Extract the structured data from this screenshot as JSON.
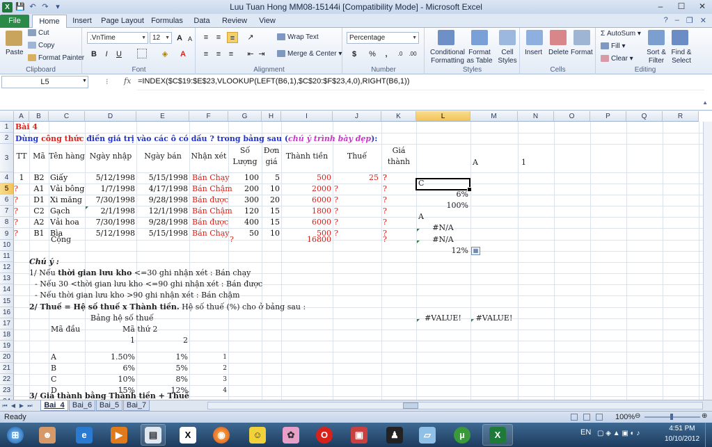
{
  "window": {
    "title": "Luu Tuan Hong MM08-15144i  [Compatibility Mode]  -  Microsoft Excel",
    "min": "–",
    "max": "☐",
    "close": "✕"
  },
  "quick_access": {
    "save": "💾",
    "undo": "↶",
    "redo": "↷",
    "more": "▾"
  },
  "tabs": [
    "File",
    "Home",
    "Insert",
    "Page Layout",
    "Formulas",
    "Data",
    "Review",
    "View"
  ],
  "ribbon": {
    "clipboard": {
      "label": "Clipboard",
      "paste": "Paste",
      "cut": "Cut",
      "copy": "Copy",
      "format_painter": "Format Painter"
    },
    "font": {
      "label": "Font",
      "name": ".VnTime",
      "size": "12",
      "bold": "B",
      "italic": "I",
      "underline": "U",
      "grow": "A",
      "shrink": "A"
    },
    "alignment": {
      "label": "Alignment",
      "wrap": "Wrap Text",
      "merge": "Merge & Center"
    },
    "number": {
      "label": "Number",
      "format": "Percentage",
      "currency": "$",
      "percent": "%",
      "comma": ","
    },
    "styles": {
      "label": "Styles",
      "conditional": "Conditional Formatting",
      "table": "Format as Table",
      "cell": "Cell Styles"
    },
    "cells": {
      "label": "Cells",
      "insert": "Insert",
      "delete": "Delete",
      "format": "Format"
    },
    "editing": {
      "label": "Editing",
      "autosum": "AutoSum",
      "fill": "Fill",
      "clear": "Clear",
      "sort": "Sort & Filter",
      "find": "Find & Select"
    }
  },
  "formula_bar": {
    "name_box": "L5",
    "fx": "fx",
    "formula": "=INDEX($C$19:$E$23,VLOOKUP(LEFT(B6,1),$C$20:$F$23,4,0),RIGHT(B6,1))"
  },
  "columns": [
    "A",
    "B",
    "C",
    "D",
    "E",
    "F",
    "G",
    "H",
    "I",
    "J",
    "K",
    "L",
    "M",
    "N",
    "O",
    "P",
    "Q",
    "R"
  ],
  "rows": [
    "1",
    "2",
    "3",
    "4",
    "5",
    "6",
    "7",
    "8",
    "9",
    "10",
    "11",
    "12",
    "13",
    "14",
    "15",
    "16",
    "17",
    "18",
    "19",
    "20",
    "21",
    "22",
    "23",
    "24"
  ],
  "cells": {
    "title": "Bài 4",
    "r2_a": "Dùng ",
    "r2_b": "công thức",
    "r2_c": " điền giá trị vào các ô có dấu ? trong bảng sau (",
    "r2_d": "chú ý trình bày đẹp",
    "r2_e": "):",
    "h_tt": "TT",
    "h_ma": "Mã",
    "h_ten": "Tên hàng",
    "h_nhap": "Ngày nhập",
    "h_ban": "Ngày bán",
    "h_nx": "Nhận xét",
    "h_sl1": "Số",
    "h_sl2": "Lượng",
    "h_dg1": "Đơn",
    "h_dg2": "giá",
    "h_tt2": "Thành tiền",
    "h_thue": "Thuế",
    "h_gt1": "Giá",
    "h_gt2": "thành",
    "L3": "A",
    "N3": "1",
    "L5": "C",
    "L6": "6%",
    "L7": "100%",
    "L8": "A",
    "L9": "#N/A",
    "L10": "#N/A",
    "L11": "12%",
    "note_head": "Chú ý :",
    "n1a": "1/  Nếu ",
    "n1b": "thời gian lưu kho",
    "n1c": " <=30 ghi nhận xét : Bán chạy",
    "n2": "- Nếu 30 <thời gian lưu kho <=90 ghi nhận xét : Bán được",
    "n3": "- Nếu thời gian lưu kho >90 ghi nhận xét : Bán chậm",
    "n16a": "2/ Thuế = Hệ số thuế x Thành tiền.",
    "n16b": " Hệ số thuế (%) cho ở bảng sau :",
    "L17": "#VALUE!",
    "M17": "#VALUE!",
    "bhs": "Bảng hệ số thuế",
    "madau": "Mã đầu",
    "mathu": "Mã thứ 2",
    "c1": "1",
    "c2": "2",
    "n24": "3/ Giá thành bằng Thành tiền + Thuế",
    "tong": "Cộng",
    "tong_g": "?",
    "tong_i": "16800",
    "tong_k": "?"
  },
  "items": [
    {
      "tt": "1",
      "ma": "B2",
      "ten": "Giấy",
      "nhap": "5/12/1998",
      "ban": "5/15/1998",
      "nx": "Bán Chạy",
      "sl": "100",
      "dg": "5",
      "tien": "500",
      "j": "25",
      "k": "?"
    },
    {
      "tt": "?",
      "ma": "A1",
      "ten": "Vải bông",
      "nhap": "1/7/1998",
      "ban": "4/17/1998",
      "nx": "Bán Chậm",
      "sl": "200",
      "dg": "10",
      "tien": "2000",
      "j": "?",
      "k": "?"
    },
    {
      "tt": "?",
      "ma": "D1",
      "ten": "Xi măng",
      "nhap": "7/30/1998",
      "ban": "9/28/1998",
      "nx": "Bán được",
      "sl": "300",
      "dg": "20",
      "tien": "6000",
      "j": "?",
      "k": "?"
    },
    {
      "tt": "?",
      "ma": "C2",
      "ten": "Gạch",
      "nhap": "2/1/1998",
      "ban": "12/1/1998",
      "nx": "Bán Chậm",
      "sl": "120",
      "dg": "15",
      "tien": "1800",
      "j": "?",
      "k": "?"
    },
    {
      "tt": "?",
      "ma": "A2",
      "ten": "Vải hoa",
      "nhap": "7/30/1998",
      "ban": "9/28/1998",
      "nx": "Bán được",
      "sl": "400",
      "dg": "15",
      "tien": "6000",
      "j": "?",
      "k": "?"
    },
    {
      "tt": "?",
      "ma": "B1",
      "ten": "Bìa",
      "nhap": "5/12/1998",
      "ban": "5/15/1998",
      "nx": "Bán Chạy",
      "sl": "50",
      "dg": "10",
      "tien": "500",
      "j": "?",
      "k": "?"
    }
  ],
  "tax_table": [
    {
      "code": "A",
      "v1": "1.50%",
      "v2": "1%",
      "f": "1"
    },
    {
      "code": "B",
      "v1": "6%",
      "v2": "5%",
      "f": "2"
    },
    {
      "code": "C",
      "v1": "10%",
      "v2": "8%",
      "f": "3"
    },
    {
      "code": "D",
      "v1": "15%",
      "v2": "12%",
      "f": "4"
    }
  ],
  "sheets": [
    "Bai_4",
    "Bai_6",
    "Bai_5",
    "Bai_7"
  ],
  "status": {
    "ready": "Ready",
    "zoom": "100%"
  },
  "taskbar": {
    "lang": "EN",
    "time": "4:51 PM",
    "date": "10/10/2012"
  },
  "colors": {
    "red": "#d8211a",
    "green": "#1a8a3a",
    "blue": "#2233cc",
    "magenta": "#cc33cc"
  }
}
